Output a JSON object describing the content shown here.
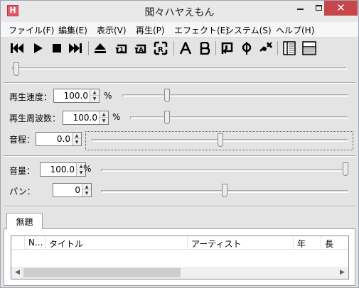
{
  "window": {
    "title": "聞々ハヤえもん",
    "icon_letter": "H"
  },
  "menu": [
    {
      "label": "ファイル(F)"
    },
    {
      "label": "編集(E)"
    },
    {
      "label": "表示(V)"
    },
    {
      "label": "再生(P)"
    },
    {
      "label": "エフェクト(E)"
    },
    {
      "label": "システム(S)"
    },
    {
      "label": "ヘルプ(H)"
    }
  ],
  "toolbar": {
    "buttons": [
      "previous-icon",
      "play-icon",
      "stop-icon",
      "next-icon",
      "open-icon",
      "repeat-one-icon",
      "repeat-all-icon",
      "random-icon",
      "marker-a-icon",
      "marker-b-icon",
      "loop-ab-icon",
      "add-marker-icon",
      "delete-marker-icon",
      "explorer-pane-icon",
      "playlist-pane-icon"
    ]
  },
  "seek": {
    "position": 0
  },
  "controls": {
    "speed": {
      "label": "再生速度：",
      "value": "100.0",
      "unit": "%",
      "level": 0.19
    },
    "frequency": {
      "label": "再生周波数：",
      "value": "100.0",
      "unit": "%",
      "level": 0.16
    },
    "pitch": {
      "label": "音程：",
      "value": "0.0",
      "level": 0.5
    },
    "volume": {
      "label": "音量：",
      "value": "100.0",
      "unit": "%",
      "level": 1.0
    },
    "pan": {
      "label": "パン：",
      "value": "0",
      "level": 0.5
    }
  },
  "playlist": {
    "tab_label": "無題",
    "columns": [
      "N...",
      "タイトル",
      "アーティスト",
      "年",
      "長"
    ]
  },
  "colors": {
    "close_button": "#c7464b",
    "accent_icon": "#e35b6c"
  }
}
